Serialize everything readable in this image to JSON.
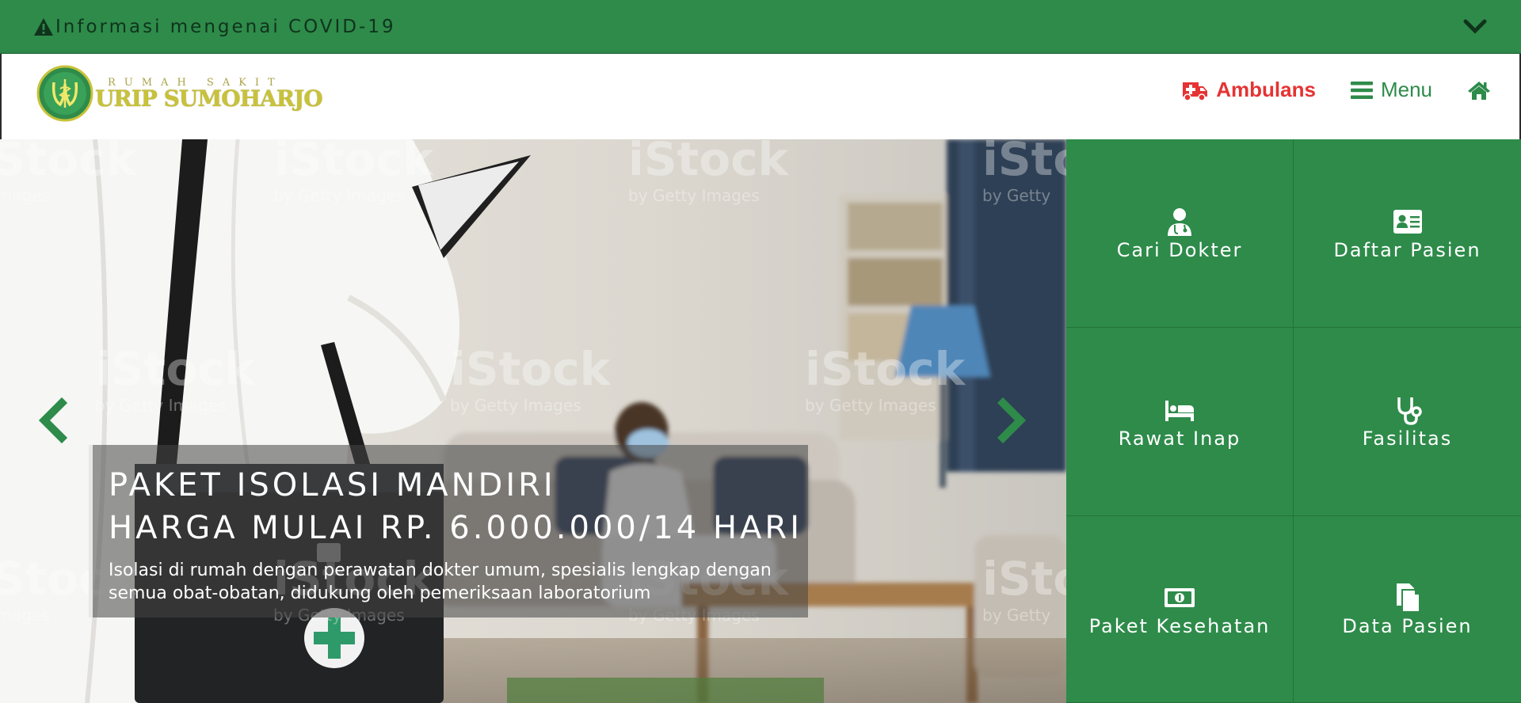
{
  "banner": {
    "text": "Informasi mengenai COVID-19",
    "warn_icon": "warning-icon",
    "toggle_icon": "chevron-down-icon"
  },
  "header": {
    "logo": {
      "subtitle": "RUMAH SAKIT",
      "name": "URIP SUMOHARJO"
    },
    "nav": {
      "ambulance_label": "Ambulans",
      "menu_label": "Menu"
    }
  },
  "hero": {
    "title_line1": "PAKET ISOLASI MANDIRI",
    "title_line2": "HARGA MULAI RP. 6.000.000/14 HARI",
    "description": "Isolasi di rumah dengan perawatan dokter umum, spesialis lengkap dengan semua obat-obatan, didukung oleh pemeriksaan laboratorium",
    "watermark_brand": "iStock",
    "watermark_sub": "by Getty Images"
  },
  "tiles": [
    {
      "label": "Cari Dokter",
      "icon": "doctor-icon"
    },
    {
      "label": "Daftar Pasien",
      "icon": "id-card-icon"
    },
    {
      "label": "Rawat Inap",
      "icon": "bed-icon"
    },
    {
      "label": "Fasilitas",
      "icon": "stethoscope-icon"
    },
    {
      "label": "Paket Kesehatan",
      "icon": "money-icon"
    },
    {
      "label": "Data Pasien",
      "icon": "documents-icon"
    }
  ],
  "colors": {
    "brand_green": "#2e8b4a",
    "ambulance_red": "#e53333",
    "logo_gold": "#c8c23a"
  }
}
